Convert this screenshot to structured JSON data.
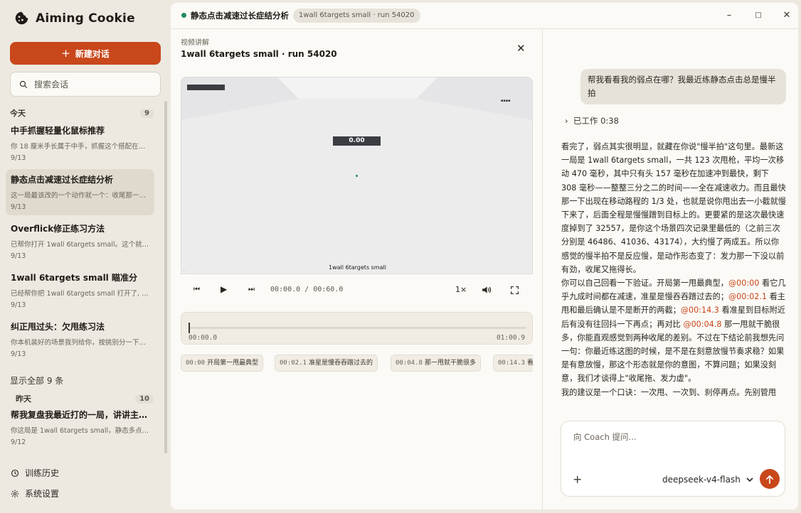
{
  "app": {
    "name": "Aiming Cookie"
  },
  "sidebar": {
    "new_chat_label": "新建对话",
    "search_placeholder": "搜索会话",
    "groups": [
      {
        "title": "今天",
        "count": "9",
        "items": [
          {
            "title": "中手抓握轻量化鼠标推荐",
            "preview": "你 18 厘米手长属于中手，抓握这个搭配在鼠…",
            "date": "9/13"
          },
          {
            "title": "静态点击减速过长症结分析",
            "preview": "这一局最该改的一个动作就一个：收尾那一下…",
            "date": "9/13"
          },
          {
            "title": "Overflick修正练习方法",
            "preview": "已帮你打开 1wall 6targets small。这个就是…",
            "date": "9/13"
          },
          {
            "title": "1wall 6targets small 瞄准分",
            "preview": "已经帮你把 1wall 6targets small 打开了, Ko…",
            "date": "9/13"
          },
          {
            "title": "纠正甩过头：欠甩练习法",
            "preview": "你本机装好的场景我列给你，按挑别分一下一…",
            "date": "9/13"
          }
        ]
      },
      {
        "title": "昨天",
        "count": "10",
        "items": [
          {
            "title": "帮我复盘我最近打的一局，讲讲主要…",
            "preview": "你这局是 1wall 6targets small，静态多点甩…",
            "date": "9/12"
          }
        ]
      }
    ],
    "show_all": "显示全部 9 条",
    "bottom": {
      "history": "训练历史",
      "settings": "系统设置"
    }
  },
  "titlebar": {
    "title": "静态点击减速过长症结分析",
    "badge": "1wall 6targets small · run 54020"
  },
  "video": {
    "label": "视频讲解",
    "title": "1wall 6targets small · run 54020",
    "score": "0.00",
    "caption": "1wall 6targets small",
    "time_display": "00:00.0 / 00:60.0",
    "speed": "1×",
    "timeline_start": "00:00.0",
    "timeline_end": "01:00.9",
    "chips": [
      {
        "time": "00:00",
        "text": "开局第一甩最典型"
      },
      {
        "time": "00:02.1",
        "text": "准星是慢吞吞蹭过去的"
      },
      {
        "time": "00:04.8",
        "text": "那一甩就干脆很多"
      },
      {
        "time": "00:14.3",
        "text": "看准"
      }
    ]
  },
  "chat": {
    "user_message": "帮我看看我的弱点在哪？我最近练静态点击总是慢半拍",
    "worked_label": "已工作 0:38",
    "answer": {
      "p1": "看完了，弱点其实很明显，就藏在你说\"慢半拍\"这句里。最新这一局是 1wall 6targets small，一共 123 次甩枪，平均一次移动 470 毫秒，其中只有头 157 毫秒在加速冲到最快，剩下 308 毫秒——整整三分之二的时间——全在减速收力。而且最快那一下出现在移动路程的 1/3 处，也就是说你甩出去一小截就慢下来了，后面全程是慢慢蹭到目标上的。更要紧的是这次最快速度掉到了 32557，是你这个场景四次记录里最低的（之前三次分别是 46486、41036、43174），大约慢了两成五。所以你感觉的慢半拍不是反应慢，是动作形态变了：发力那一下没以前有劲，收尾又拖得长。",
      "p2a": "你可以自己回看一下验证。开局第一甩最典型，",
      "ts1": "@00:00",
      "p2b": " 看它几乎九成时间都在减速，准星是慢吞吞蹭过去的；",
      "ts2": "@00:02.1",
      "p2c": " 看主甩和最后确认是不是断开的两截；",
      "ts3": "@00:14.3",
      "p2d": " 看准星到目标附近后有没有往回抖一下再点；再对比 ",
      "ts4": "@00:04.8",
      "p2e": " 那一甩就干脆很多，你能直观感觉到两种收尾的差别。不过在下结论前我想先问一句：你最近练这图的时候，是不是在刻意放慢节奏求稳？如果是有意放慢，那这个形态就是你的意图，不算问题；如果没刻意，我们才谈得上\"收尾拖、发力虚\"。",
      "p3": "我的建议是一个口诀：一次甩、一次到、刹停再点。先别管甩"
    },
    "input_placeholder": "向 Coach 提问...",
    "model": "deepseek-v4-flash"
  },
  "colors": {
    "accent": "#c8471b",
    "status_dot": "#1f8a5b"
  }
}
